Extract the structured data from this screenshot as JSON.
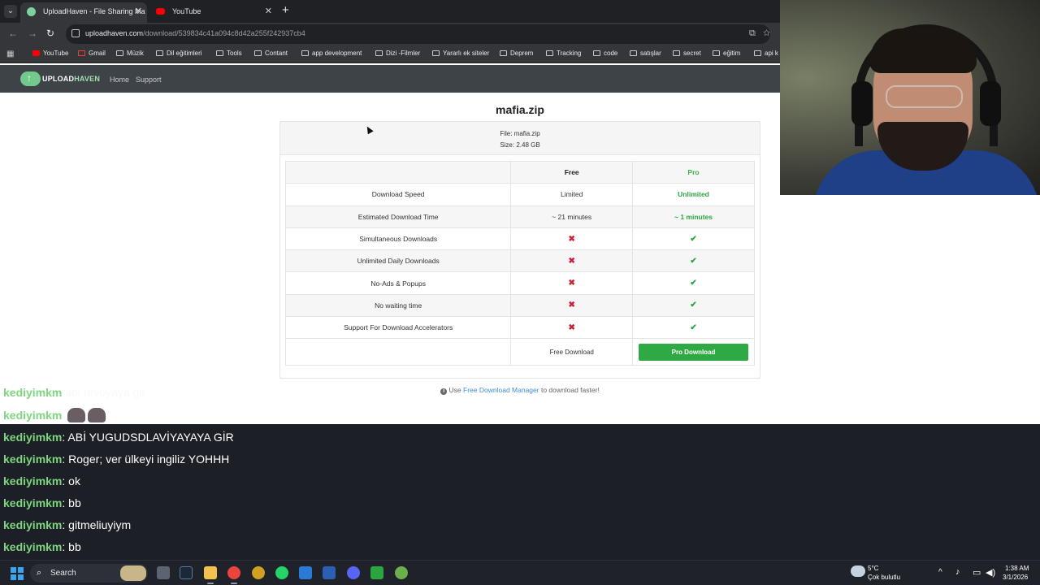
{
  "browser": {
    "tabs": [
      {
        "title": "UploadHaven - File Sharing Ma",
        "active": true
      },
      {
        "title": "YouTube",
        "active": false
      }
    ],
    "url_host": "uploadhaven.com",
    "url_path": "/download/539834c41a094c8d42a255f242937cb4",
    "bookmarks": [
      "YouTube",
      "Gmail",
      "Müzik",
      "Dil eğitimleri",
      "Tools",
      "Contant",
      "app development",
      "Dizi -Filmler",
      "Yararlı ek siteler",
      "Deprem",
      "Tracking",
      "code",
      "satışlar",
      "secret",
      "eğitim",
      "api k"
    ]
  },
  "site": {
    "logo_upload": "UPLOAD",
    "logo_haven": "HAVEN",
    "nav": [
      "Home",
      "Support"
    ]
  },
  "download": {
    "title": "mafia.zip",
    "file_line": "File: mafia.zip",
    "size_line": "Size: 2.48 GB",
    "col_free": "Free",
    "col_pro": "Pro",
    "rows": [
      {
        "feature": "Download Speed",
        "free": "Limited",
        "pro": "Unlimited"
      },
      {
        "feature": "Estimated Download Time",
        "free": "~ 21 minutes",
        "pro": "~ 1 minutes"
      },
      {
        "feature": "Simultaneous Downloads",
        "free": "✖",
        "pro": "✔"
      },
      {
        "feature": "Unlimited Daily Downloads",
        "free": "✖",
        "pro": "✔"
      },
      {
        "feature": "No-Ads & Popups",
        "free": "✖",
        "pro": "✔"
      },
      {
        "feature": "No waiting time",
        "free": "✖",
        "pro": "✔"
      },
      {
        "feature": "Support For Download Accelerators",
        "free": "✖",
        "pro": "✔"
      }
    ],
    "free_button": "Free Download",
    "pro_button": "Pro Download",
    "tip_prefix": "Use",
    "tip_link": "Free Download Manager",
    "tip_suffix": "to download faster!"
  },
  "chat": {
    "user": "kediyimkm",
    "faded_msg": "abi reveyaya gir",
    "messages": [
      "ABİ YUGUDSDLAVİYAYAYA GİR",
      "Roger; ver ülkeyi ingiliz YOHHH",
      "ok",
      "bb",
      "gitmeliuyiym",
      "bb"
    ]
  },
  "taskbar": {
    "search_label": "Search",
    "temp": "5°C",
    "weather": "Çok bulutlu",
    "time": "1:38 AM",
    "date": "3/1/2026"
  },
  "colors": {
    "accent_green": "#2ea944",
    "cross_red": "#cc2238",
    "link_blue": "#3a8fd1"
  }
}
